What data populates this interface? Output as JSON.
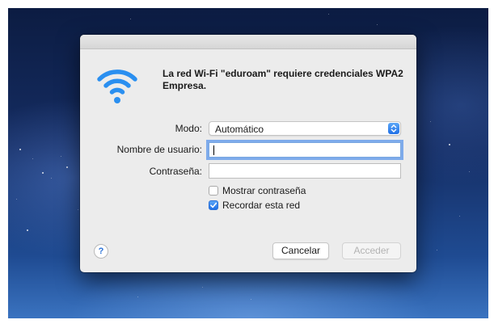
{
  "dialog": {
    "message": "La red Wi-Fi \"eduroam\" requiere credenciales WPA2 Empresa.",
    "mode_label": "Modo:",
    "mode_value": "Automático",
    "username_label": "Nombre de usuario:",
    "username_value": "",
    "password_label": "Contraseña:",
    "password_value": "",
    "show_password_label": "Mostrar contraseña",
    "show_password_checked": false,
    "remember_label": "Recordar esta red",
    "remember_checked": true,
    "help_label": "?",
    "cancel_label": "Cancelar",
    "join_label": "Acceder"
  },
  "colors": {
    "accent": "#1f6fe6",
    "wifi_icon": "#2a8ff0",
    "dialog_bg": "#ececec"
  }
}
